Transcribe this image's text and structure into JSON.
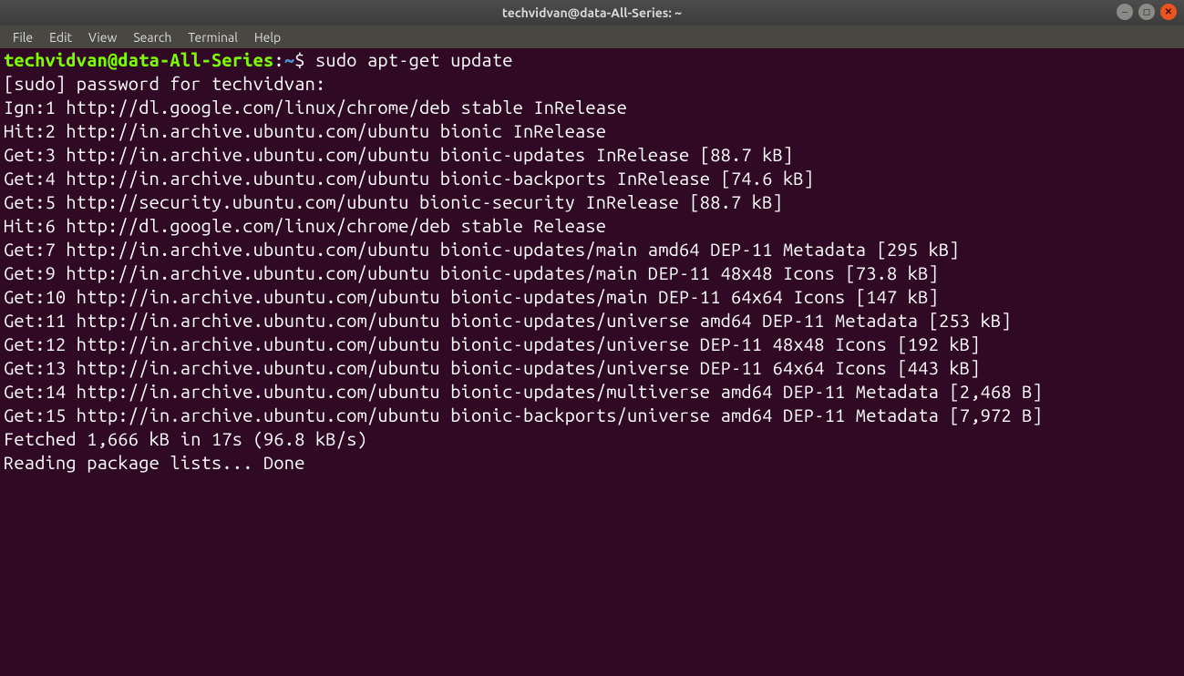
{
  "window": {
    "title": "techvidvan@data-All-Series: ~"
  },
  "menubar": {
    "items": [
      "File",
      "Edit",
      "View",
      "Search",
      "Terminal",
      "Help"
    ]
  },
  "prompt": {
    "user_host": "techvidvan@data-All-Series",
    "separator": ":",
    "path": "~",
    "symbol": "$",
    "command": "sudo apt-get update"
  },
  "output_lines": [
    "[sudo] password for techvidvan: ",
    "Ign:1 http://dl.google.com/linux/chrome/deb stable InRelease",
    "Hit:2 http://in.archive.ubuntu.com/ubuntu bionic InRelease",
    "Get:3 http://in.archive.ubuntu.com/ubuntu bionic-updates InRelease [88.7 kB]",
    "Get:4 http://in.archive.ubuntu.com/ubuntu bionic-backports InRelease [74.6 kB]",
    "Get:5 http://security.ubuntu.com/ubuntu bionic-security InRelease [88.7 kB]",
    "Hit:6 http://dl.google.com/linux/chrome/deb stable Release",
    "Get:7 http://in.archive.ubuntu.com/ubuntu bionic-updates/main amd64 DEP-11 Metadata [295 kB]",
    "Get:9 http://in.archive.ubuntu.com/ubuntu bionic-updates/main DEP-11 48x48 Icons [73.8 kB]",
    "Get:10 http://in.archive.ubuntu.com/ubuntu bionic-updates/main DEP-11 64x64 Icons [147 kB]",
    "Get:11 http://in.archive.ubuntu.com/ubuntu bionic-updates/universe amd64 DEP-11 Metadata [253 kB]",
    "Get:12 http://in.archive.ubuntu.com/ubuntu bionic-updates/universe DEP-11 48x48 Icons [192 kB]",
    "Get:13 http://in.archive.ubuntu.com/ubuntu bionic-updates/universe DEP-11 64x64 Icons [443 kB]",
    "Get:14 http://in.archive.ubuntu.com/ubuntu bionic-updates/multiverse amd64 DEP-11 Metadata [2,468 B]",
    "Get:15 http://in.archive.ubuntu.com/ubuntu bionic-backports/universe amd64 DEP-11 Metadata [7,972 B]",
    "Fetched 1,666 kB in 17s (96.8 kB/s)",
    "Reading package lists... Done"
  ]
}
